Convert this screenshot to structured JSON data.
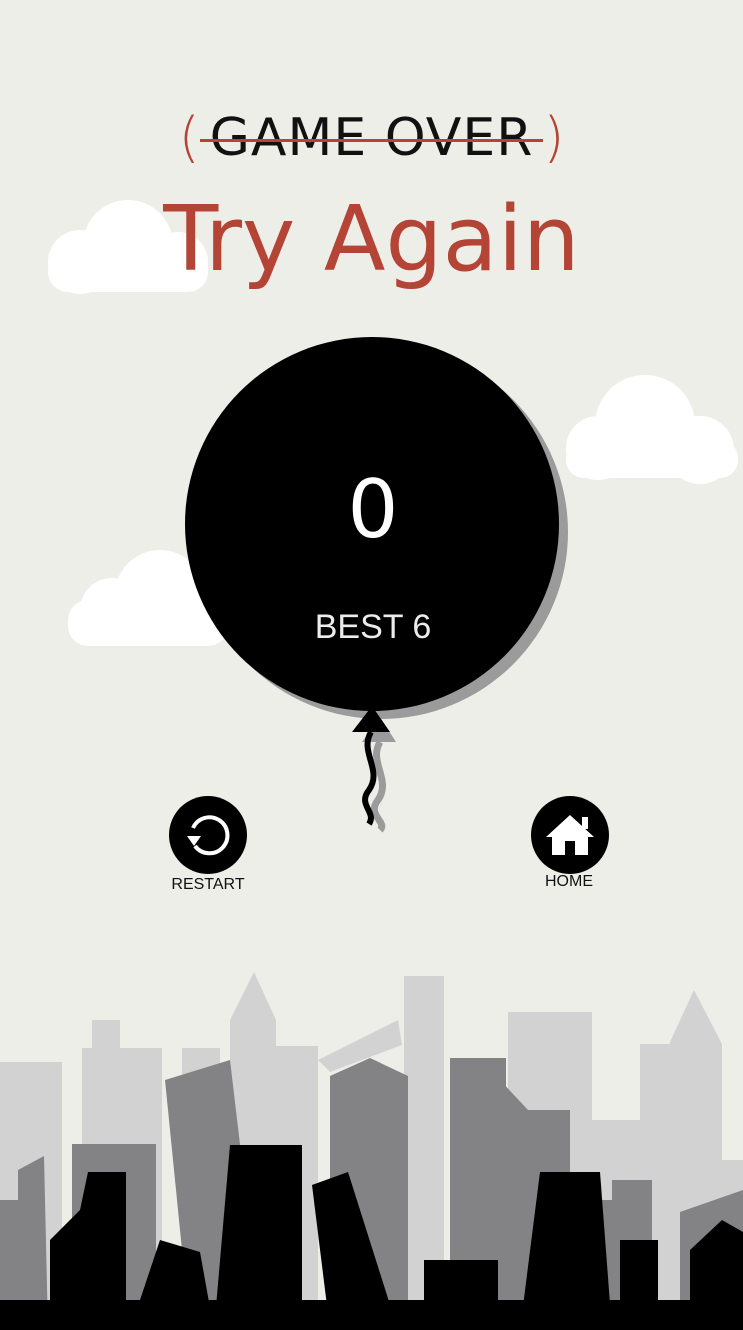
{
  "header": {
    "game_over": "GAME OVER",
    "open_paren": "(",
    "close_paren": ")",
    "subtitle": "Try Again"
  },
  "score": {
    "current": "0",
    "best_label": "BEST 6"
  },
  "buttons": {
    "restart_label": "RESTART",
    "home_label": "HOME"
  },
  "icons": {
    "restart": "restart-icon",
    "home": "home-icon"
  },
  "colors": {
    "background": "#eeeee9",
    "accent_red": "#b44436",
    "balloon": "#000000",
    "cloud": "#ffffff"
  }
}
